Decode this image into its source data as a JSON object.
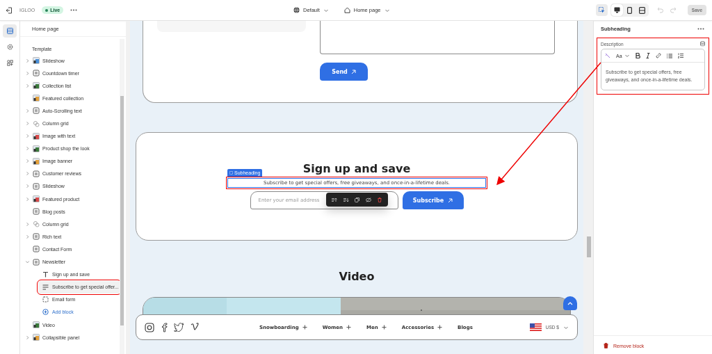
{
  "topbar": {
    "store": "IGLOO",
    "status": "Live",
    "theme": "Default",
    "page": "Home page",
    "tools": [
      {
        "kind": "inspector",
        "selected": true
      },
      {
        "kind": "desktop",
        "selected": true
      },
      {
        "kind": "mobile",
        "selected": false
      },
      {
        "kind": "fullwidth",
        "selected": false
      }
    ],
    "save": {
      "label": "Save",
      "disabled": true
    }
  },
  "rail": [
    {
      "kind": "sections",
      "selected": true
    },
    {
      "kind": "settings",
      "selected": false
    },
    {
      "kind": "apps",
      "selected": false
    }
  ],
  "sidebar": {
    "title": "Home page",
    "group": "Template",
    "items": [
      {
        "label": "Slideshow",
        "expandable": true,
        "expanded": false
      },
      {
        "label": "Countdown timer",
        "kind": "outline",
        "expandable": true,
        "expanded": false
      },
      {
        "label": "Collection list",
        "expandable": true,
        "expanded": false
      },
      {
        "label": "Featured collection",
        "expandable": false,
        "expanded": false
      },
      {
        "label": "Auto-Scrolling text",
        "kind": "outline",
        "expandable": true,
        "expanded": false
      },
      {
        "label": "Column grid",
        "kind": "faint",
        "expandable": true,
        "expanded": false
      },
      {
        "label": "Image with text",
        "expandable": true,
        "expanded": false
      },
      {
        "label": "Product shop the look",
        "expandable": true,
        "expanded": false
      },
      {
        "label": "Image banner",
        "expandable": true,
        "expanded": false
      },
      {
        "label": "Customer reviews",
        "kind": "outline",
        "expandable": true,
        "expanded": false
      },
      {
        "label": "Slideshow",
        "kind": "outline",
        "expandable": true,
        "expanded": false
      },
      {
        "label": "Featured product",
        "expandable": true,
        "expanded": false
      },
      {
        "label": "Blog posts",
        "kind": "outline",
        "expandable": false,
        "expanded": false
      },
      {
        "label": "Column grid",
        "kind": "faint",
        "expandable": true,
        "expanded": false
      },
      {
        "label": "Rich text",
        "kind": "outline",
        "expandable": true,
        "expanded": false
      },
      {
        "label": "Contact Form",
        "kind": "outline",
        "expandable": false,
        "expanded": false
      },
      {
        "label": "Newsletter",
        "kind": "outline",
        "expandable": true,
        "expanded": true,
        "children": [
          {
            "label": "Sign up and save",
            "kind": "heading",
            "selected": false,
            "highlighted": false
          },
          {
            "label": "Subscribe to get special offer...",
            "kind": "text",
            "selected": true,
            "highlighted": true
          },
          {
            "label": "Email form",
            "kind": "form",
            "selected": false,
            "highlighted": false
          },
          {
            "label": "Add block",
            "kind": "add",
            "selected": false,
            "highlighted": false
          }
        ]
      },
      {
        "label": "Video",
        "expandable": false,
        "expanded": false
      },
      {
        "label": "Collapsible panel",
        "expandable": true,
        "expanded": false
      }
    ]
  },
  "preview": {
    "contact": {
      "button": "Send"
    },
    "newsletter": {
      "heading": "Sign up and save",
      "tag": "Subheading",
      "subheading": "Subscribe to get special offers, free giveaways, and once-in-a-lifetime deals.",
      "highlighted": true,
      "email_placeholder": "Enter your email address",
      "button": "Subscribe"
    },
    "video": {
      "heading": "Video",
      "kind": "picture"
    },
    "nav": {
      "links": [
        {
          "label": "Snowboarding",
          "has_menu": true
        },
        {
          "label": "Women",
          "has_menu": true
        },
        {
          "label": "Men",
          "has_menu": true
        },
        {
          "label": "Accessories",
          "has_menu": true
        },
        {
          "label": "Blogs",
          "has_menu": false
        }
      ],
      "currency": "USD $"
    }
  },
  "inspector": {
    "title": "Subheading",
    "field_label": "Description",
    "highlighted": true,
    "font_button": "Aa",
    "value": "Subscribe to get special offers, free giveaways, and once-in-a-lifetime deals.",
    "remove": "Remove block"
  }
}
